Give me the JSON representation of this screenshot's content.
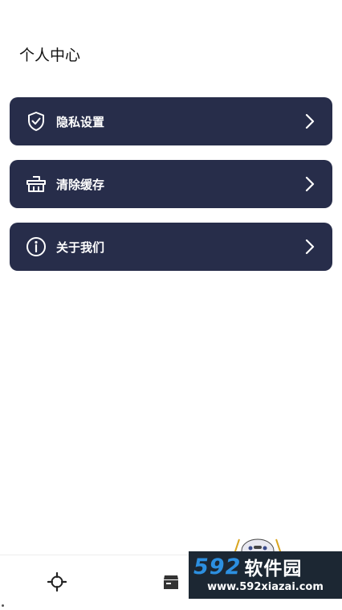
{
  "header": {
    "title": "个人中心"
  },
  "menu": {
    "items": [
      {
        "label": "隐私设置",
        "icon": "shield-check-icon"
      },
      {
        "label": "清除缓存",
        "icon": "basket-icon"
      },
      {
        "label": "关于我们",
        "icon": "info-icon"
      }
    ]
  },
  "tabbar": {
    "items": [
      {
        "icon": "crosshair-icon"
      },
      {
        "icon": "box-icon"
      }
    ]
  },
  "watermark": {
    "brand_number": "592",
    "brand_text": "软件园",
    "url": "www.592xiazai.com"
  },
  "colors": {
    "card_bg": "#272d4a",
    "card_text": "#ffffff",
    "page_bg": "#ffffff",
    "watermark_blue": "#2c8fe0"
  }
}
